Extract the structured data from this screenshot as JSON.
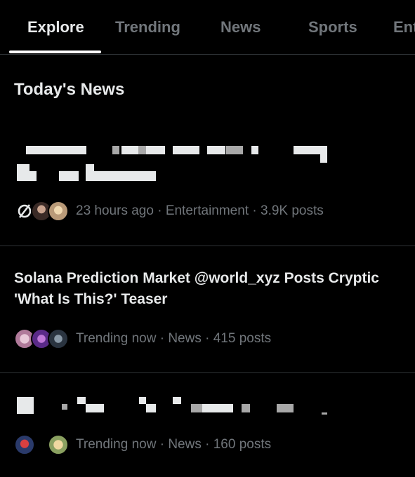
{
  "tabs": [
    {
      "label": "Explore",
      "active": true
    },
    {
      "label": "Trending",
      "active": false
    },
    {
      "label": "News",
      "active": false
    },
    {
      "label": "Sports",
      "active": false
    },
    {
      "label": "Ent",
      "active": false
    }
  ],
  "section": {
    "title": "Today's News"
  },
  "items": [
    {
      "title": "",
      "title_redacted": true,
      "time": "23 hours ago",
      "category": "Entertainment",
      "posts": "3.9K posts",
      "avatar_icons": [
        "null-symbol-icon",
        "avatar",
        "avatar"
      ]
    },
    {
      "title": "Solana Prediction Market @world_xyz Posts Cryptic 'What Is This?' Teaser",
      "title_redacted": false,
      "time": "Trending now",
      "category": "News",
      "posts": "415 posts",
      "avatar_icons": [
        "avatar",
        "avatar",
        "avatar"
      ]
    },
    {
      "title": "",
      "title_redacted": true,
      "time": "Trending now",
      "category": "News",
      "posts": "160 posts",
      "avatar_icons": [
        "avatar",
        "avatar"
      ]
    }
  ],
  "separator": " · ",
  "colors": {
    "background": "#000000",
    "text": "#e7e9ea",
    "muted": "#71767b",
    "divider": "#2f3336"
  }
}
